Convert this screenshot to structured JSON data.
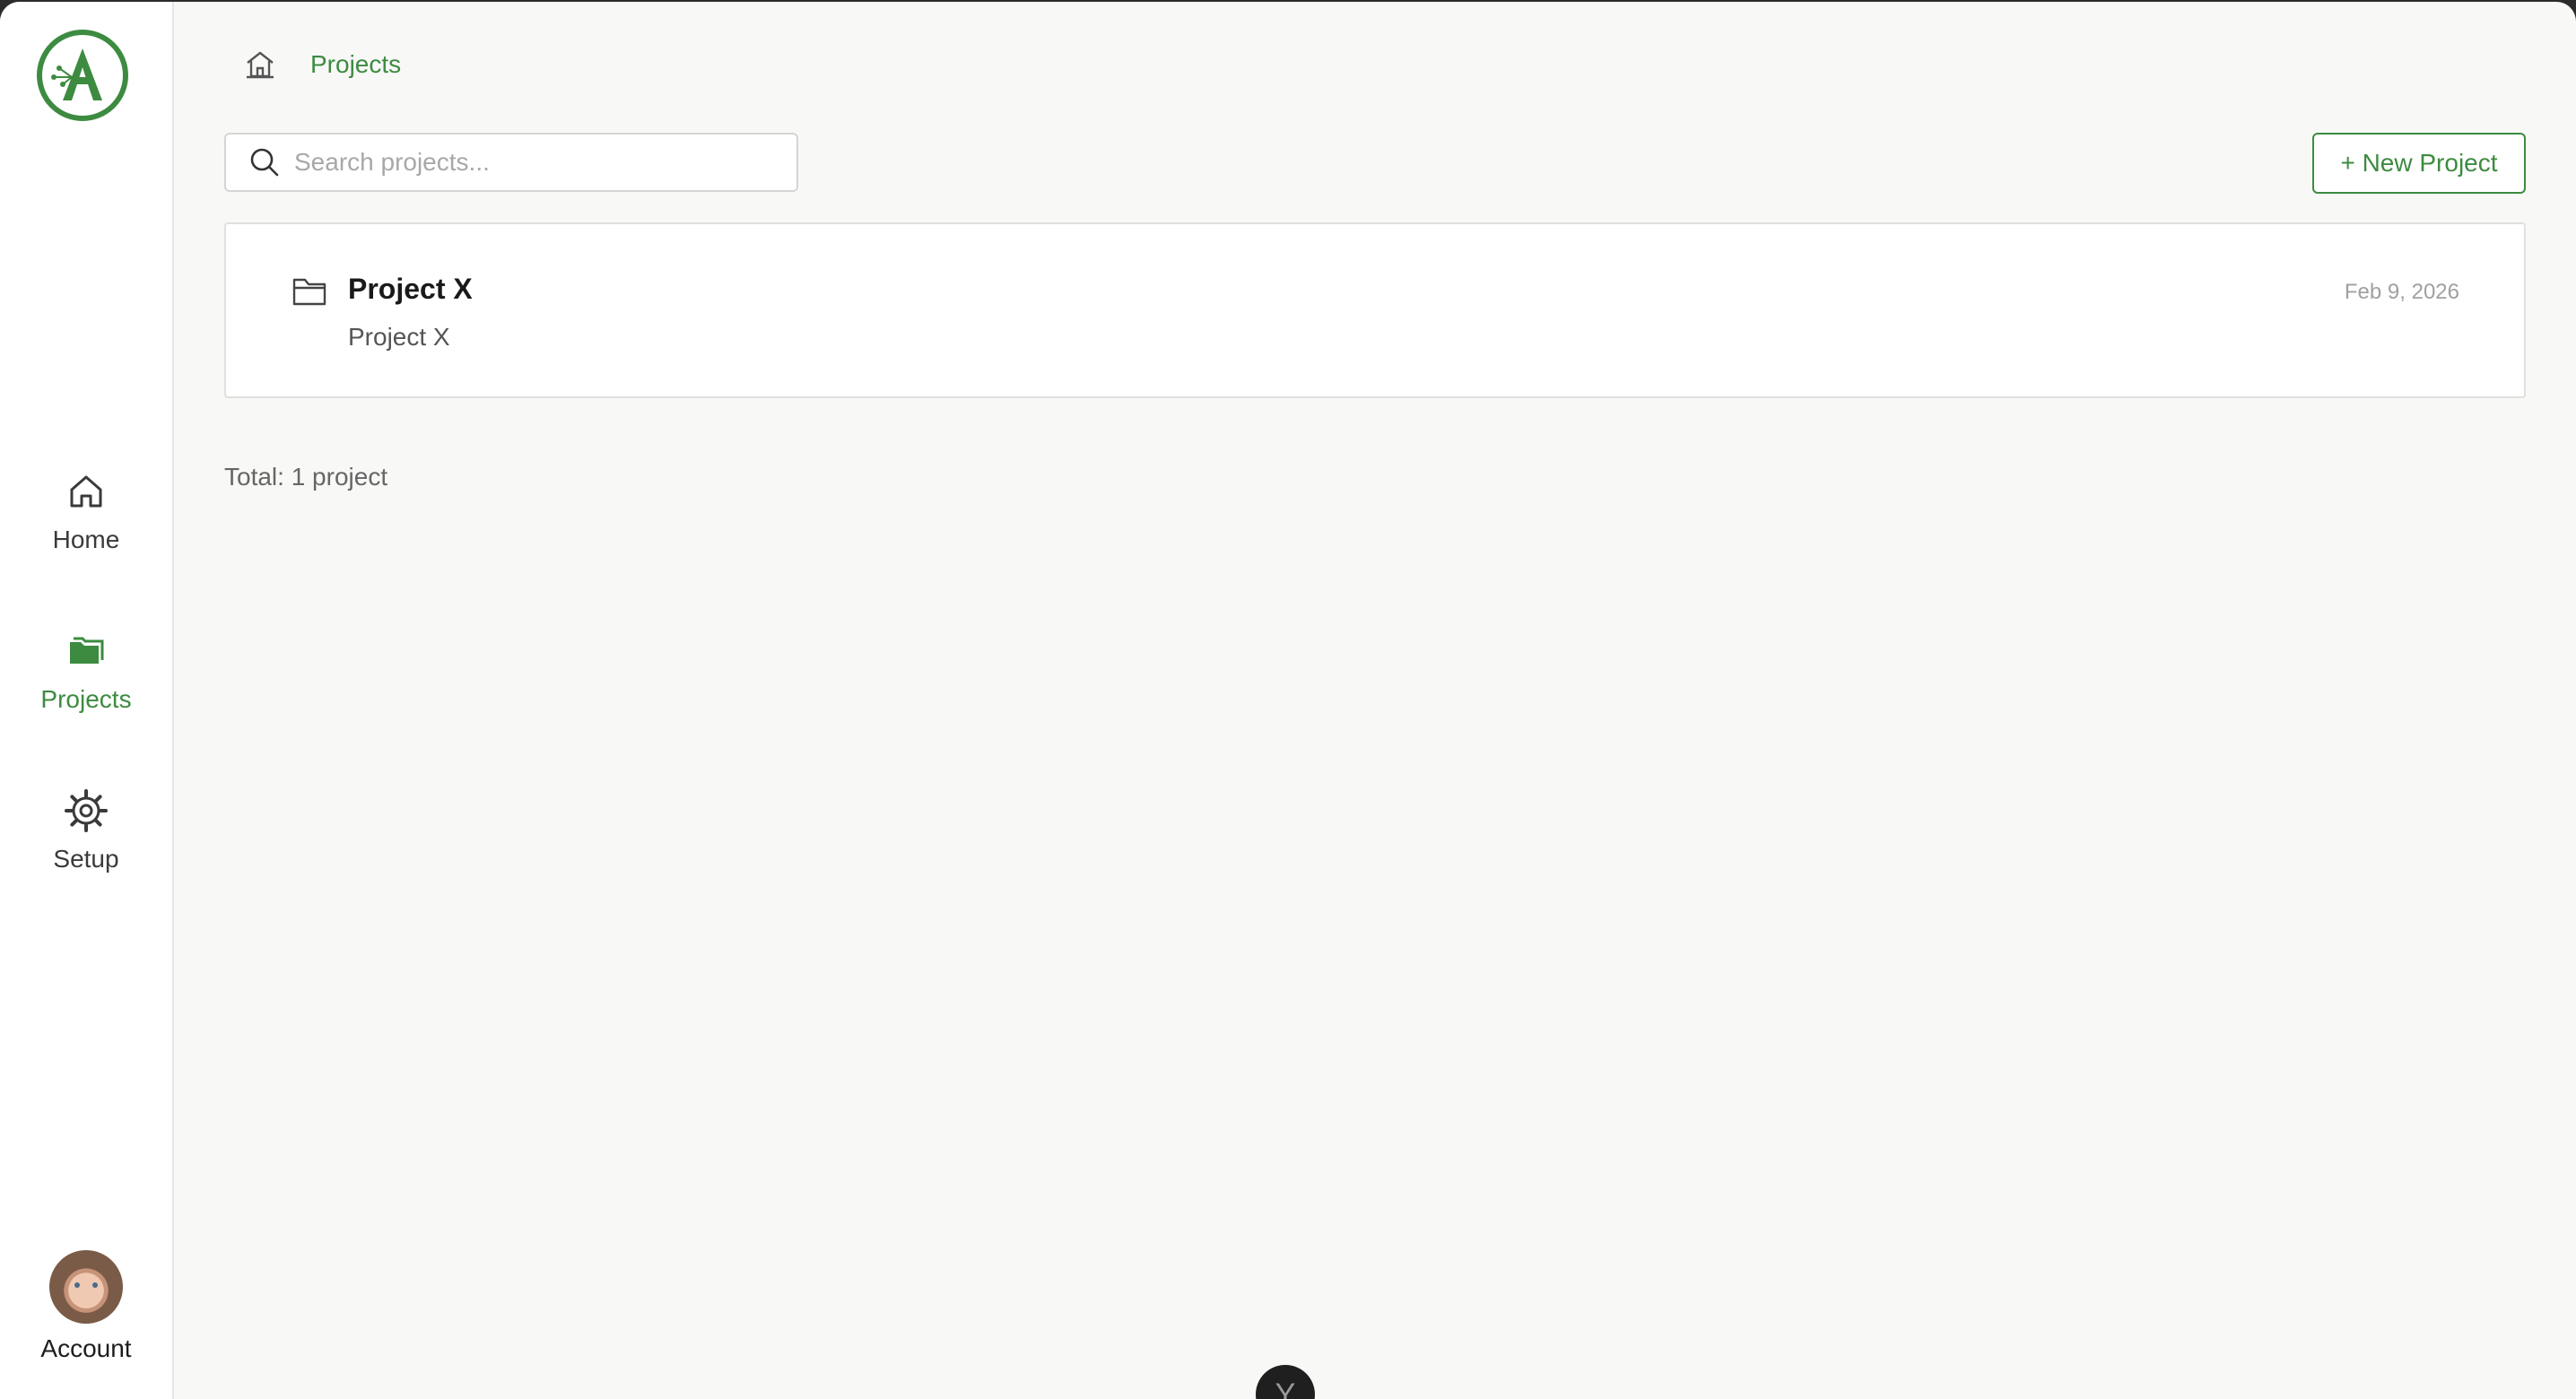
{
  "sidebar": {
    "logo_name": "app-logo",
    "items": [
      {
        "label": "Home",
        "icon": "home-icon",
        "active": false
      },
      {
        "label": "Projects",
        "icon": "folder-icon",
        "active": true
      },
      {
        "label": "Setup",
        "icon": "gear-icon",
        "active": false
      }
    ],
    "account": {
      "label": "Account",
      "icon": "avatar"
    }
  },
  "breadcrumb": {
    "home_icon": "home-icon",
    "current": "Projects"
  },
  "search": {
    "placeholder": "Search projects...",
    "value": ""
  },
  "toolbar": {
    "new_project_label": "+ New Project"
  },
  "projects": [
    {
      "name": "Project X",
      "description": "Project X",
      "date": "Feb 9, 2026",
      "icon": "folder-outline-icon"
    }
  ],
  "summary": {
    "total_text": "Total: 1 project"
  },
  "floating_badge": {
    "label": "Y"
  },
  "colors": {
    "accent": "#3d8b40",
    "background": "#f8f8f7",
    "sidebar": "#ffffff",
    "border": "#e0e0de",
    "muted_text": "#a0a0a0"
  }
}
